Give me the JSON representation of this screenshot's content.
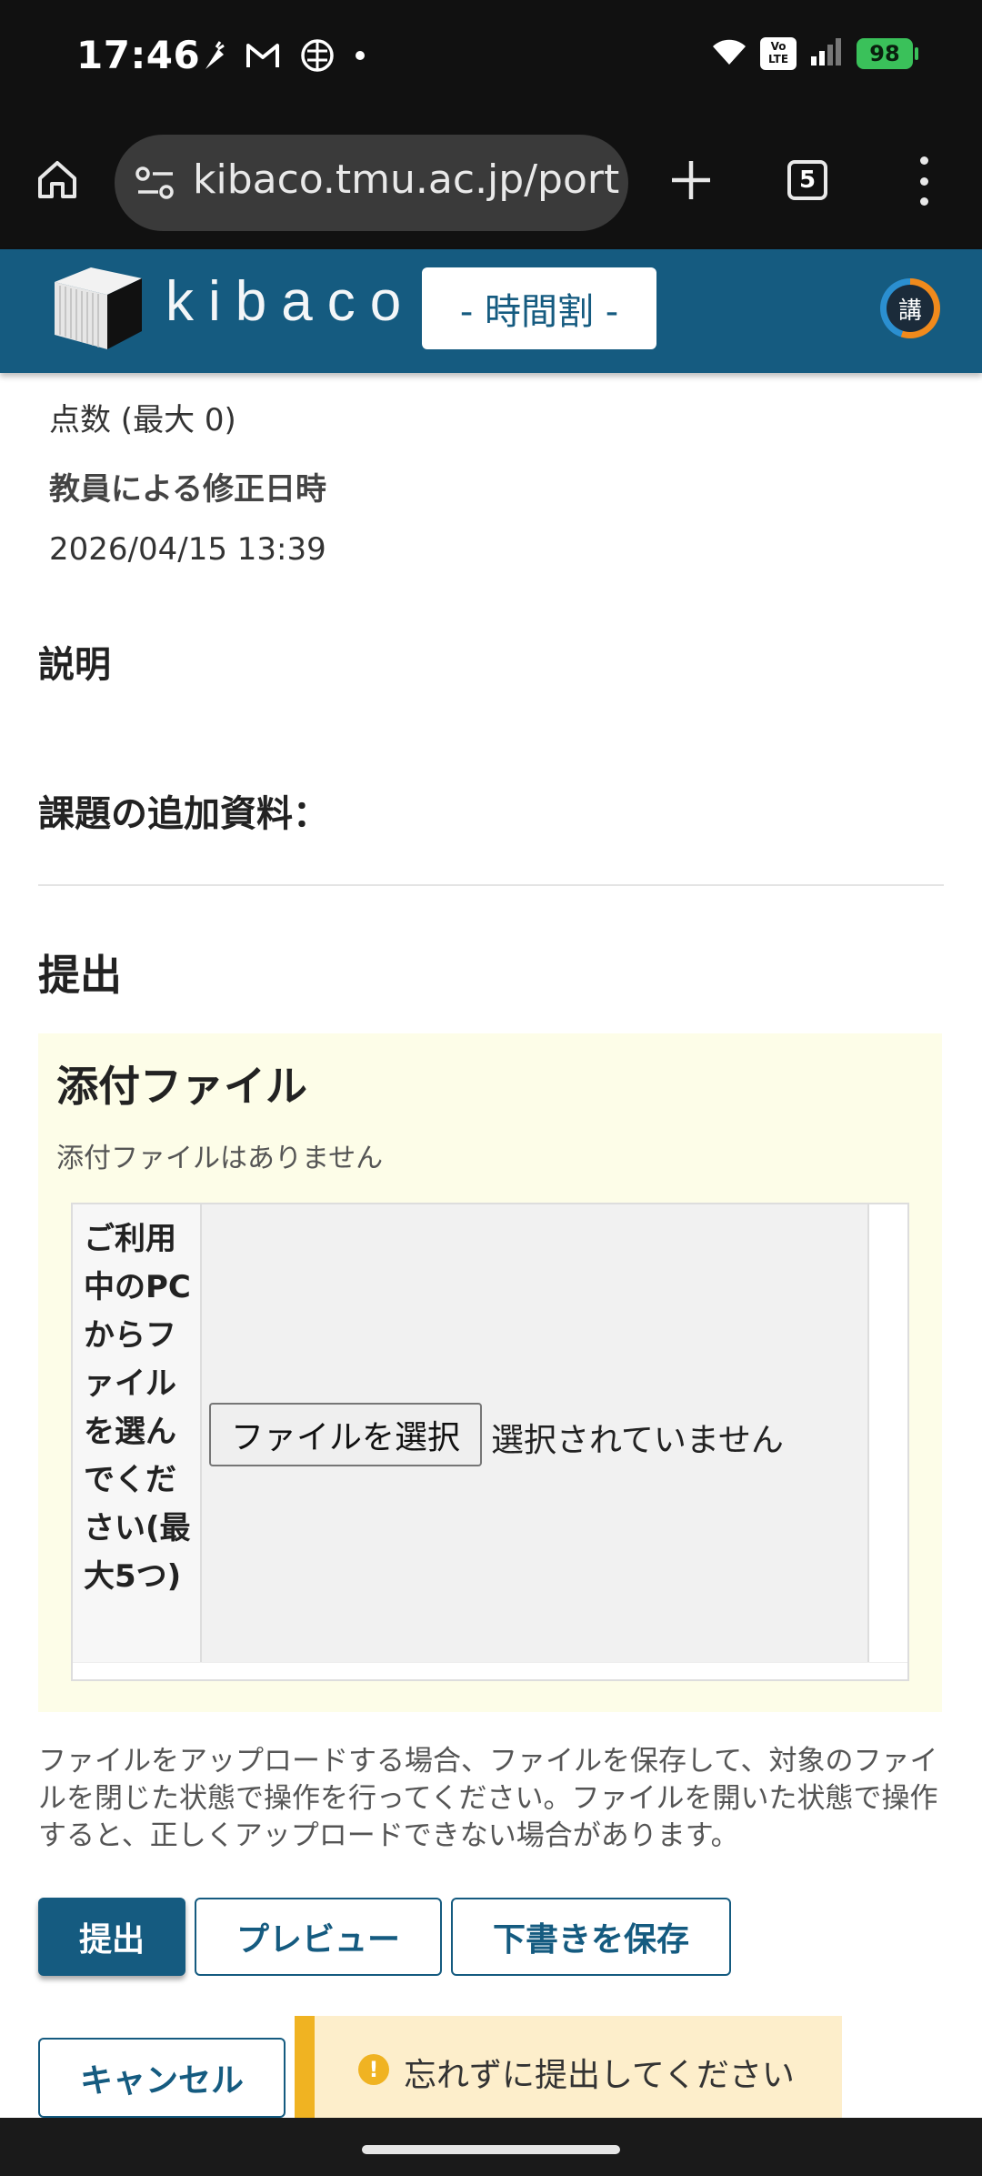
{
  "status_bar": {
    "time": "17:46",
    "battery": "98"
  },
  "browser": {
    "url": "kibaco.tmu.ac.jp/port",
    "tab_count": "5"
  },
  "header": {
    "logo_text": "kibaco",
    "timetable_label": "- 時間割 -",
    "avatar_label": "講"
  },
  "grade": {
    "score_label": "点数 (最大 0)",
    "modified_label": "教員による修正日時",
    "modified_value": "2026/04/15 13:39"
  },
  "sections": {
    "description_title": "説明",
    "extra_materials_title": "課題の追加資料：",
    "submission_title": "提出"
  },
  "attachments": {
    "title": "添付ファイル",
    "none_text": "添付ファイルはありません",
    "upload_label": "ご利用中のPCからファイルを選んでください(最大5つ)",
    "choose_file_button": "ファイルを選択",
    "no_file_text": "選択されていません"
  },
  "notice_text": "ファイルをアップロードする場合、ファイルを保存して、対象のファイルを閉じた状態で操作を行ってください。ファイルを開いた状態で操作すると、正しくアップロードできない場合があります。",
  "buttons": {
    "submit": "提出",
    "preview": "プレビュー",
    "save_draft": "下書きを保存",
    "cancel": "キャンセル"
  },
  "reminder": {
    "text": "忘れずに提出してください"
  },
  "colors": {
    "brand": "#155b80",
    "warning": "#f0b322",
    "warning_bg": "#fdeecb",
    "panel_bg": "#fdfde8"
  }
}
